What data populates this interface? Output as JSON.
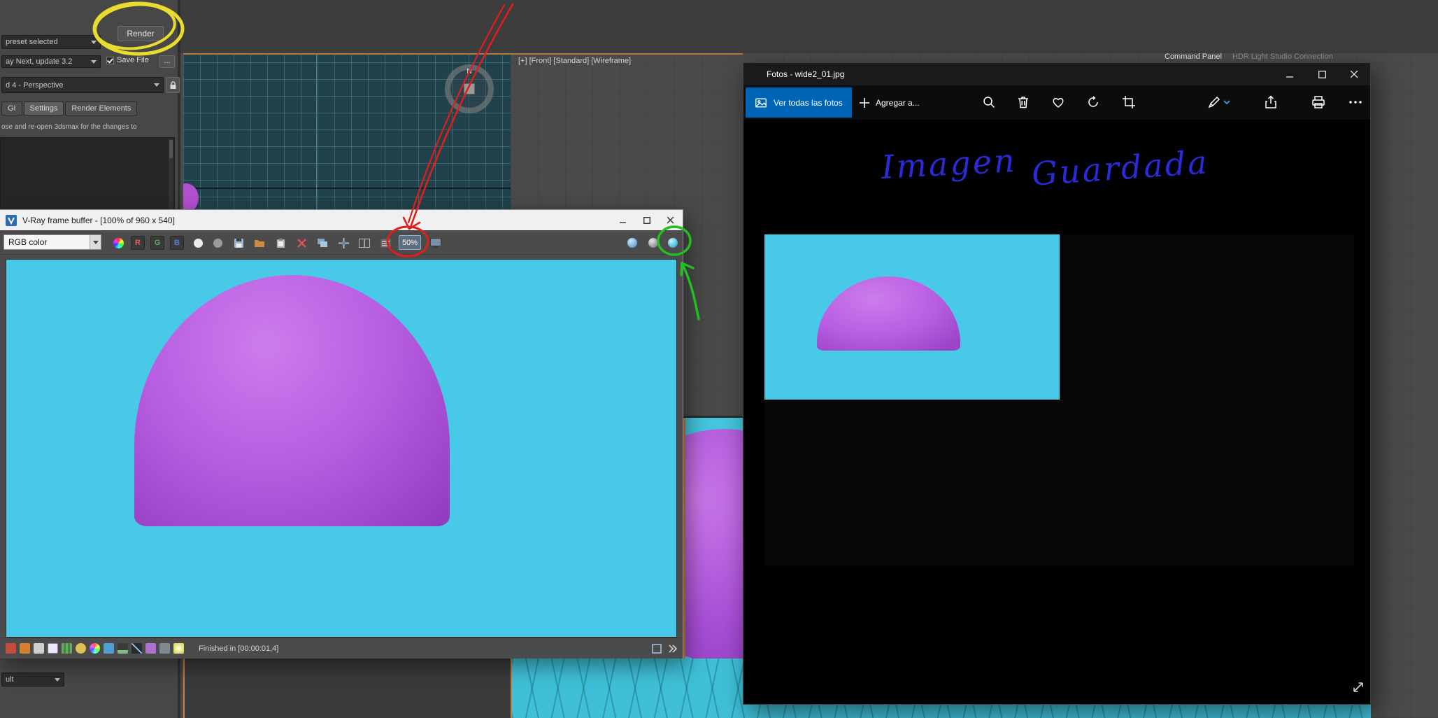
{
  "colors": {
    "accent_blue": "#0064b6",
    "render_background": "#48c9e8",
    "dome_purple": "#b85fe2",
    "viewport_orange_border": "#c97f3e",
    "annotation_red": "#e11d1d",
    "annotation_yellow": "#f2e42e",
    "annotation_green": "#1fc01f",
    "handwriting_blue": "#2a2ad8"
  },
  "max": {
    "render_button": "Render",
    "preset_dropdown": "preset selected",
    "engine_dropdown": "ay Next, update 3.2",
    "save_file": "Save File",
    "more_button": "...",
    "view_dropdown": "d 4 - Perspective",
    "tabs": [
      "GI",
      "Settings",
      "Render Elements"
    ],
    "note": "ose and re-open 3dsmax for the changes to",
    "bottom_dropdown": "ult",
    "viewport_label": "[+] [Front] [Standard] [Wireframe]",
    "command_panel_tab": "Command Panel",
    "hdr_tab": "HDR Light Studio Connection",
    "gizmo_north": "N"
  },
  "vfb": {
    "title": "V-Ray frame buffer - [100% of 960 x 540]",
    "channel_select": "RGB color",
    "channels": [
      "R",
      "G",
      "B"
    ],
    "zoom_level": "50%",
    "status": "Finished in [00:00:01,4]"
  },
  "fotos": {
    "title": "Fotos - wide2_01.jpg",
    "view_all": "Ver todas las fotos",
    "add_to": "Agregar a...",
    "annotation_word1": "Imagen",
    "annotation_word2": "Guardada"
  }
}
